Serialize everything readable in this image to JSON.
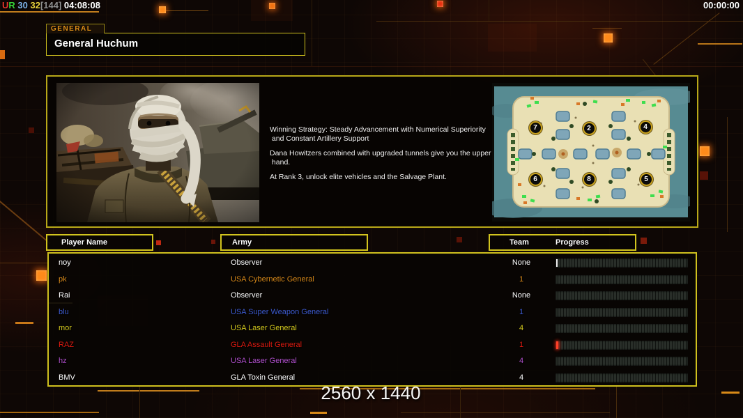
{
  "theme": {
    "accent_yellow": "#cfc01e",
    "circuit_orange": "#ff8a1a",
    "tab_orange": "#e09018"
  },
  "hud": {
    "top_left_segments": [
      {
        "text": "U",
        "color": "#e8372a"
      },
      {
        "text": "R",
        "color": "#38d438"
      },
      {
        "text": " 30",
        "color": "#7fb2e8"
      },
      {
        "text": " 32",
        "color": "#e8d23c"
      },
      {
        "text": "[144]",
        "color": "#8f8f8f"
      },
      {
        "text": " 04:08:08",
        "color": "#ffffff"
      }
    ],
    "top_right_time": "00:00:00",
    "resolution_label": "2560 x 1440"
  },
  "general_panel": {
    "tab_label": "GENERAL",
    "name": "General Huchum",
    "strategy_lines": [
      "Winning Strategy: Steady Advancement with Numerical Superiority",
      " and Constant Artillery Support",
      "",
      "Dana Howitzers combined with upgraded tunnels give you the upper",
      " hand.",
      "",
      "At Rank 3, unlock elite vehicles and the Salvage Plant."
    ]
  },
  "map_preview": {
    "start_positions": [
      "7",
      "2",
      "4",
      "6",
      "8",
      "5"
    ]
  },
  "lobby_table": {
    "headers": {
      "player": "Player Name",
      "army": "Army",
      "team": "Team",
      "progress": "Progress"
    },
    "rows": [
      {
        "name": "noy",
        "army": "Observer",
        "team": "None",
        "color": "#ffffff",
        "progress_marker": "cursor"
      },
      {
        "name": "pk",
        "army": "USA Cybernetic General",
        "team": "1",
        "color": "#d8891a",
        "progress_marker": ""
      },
      {
        "name": "Rai",
        "army": "Observer",
        "team": "None",
        "color": "#ffffff",
        "progress_marker": ""
      },
      {
        "name": "blu",
        "army": "USA Super Weapon General",
        "team": "1",
        "color": "#3d5bd0",
        "progress_marker": ""
      },
      {
        "name": "mor",
        "army": "USA Laser General",
        "team": "4",
        "color": "#d4c91e",
        "progress_marker": ""
      },
      {
        "name": "RAZ",
        "army": "GLA Assault General",
        "team": "1",
        "color": "#dc1a10",
        "progress_marker": "red"
      },
      {
        "name": "hz",
        "army": "USA Laser General",
        "team": "4",
        "color": "#b050cc",
        "progress_marker": ""
      },
      {
        "name": "BMV",
        "army": "GLA Toxin General",
        "team": "4",
        "color": "#ffffff",
        "progress_marker": ""
      }
    ]
  }
}
